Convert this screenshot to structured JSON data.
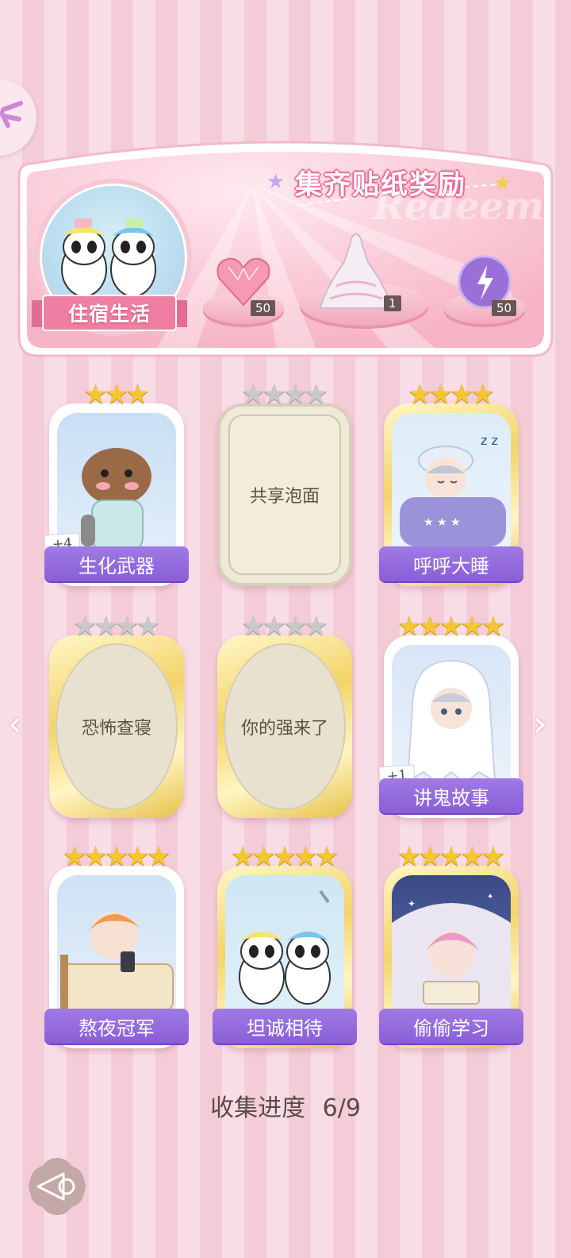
{
  "banner": {
    "title": "集齐贴纸奖励",
    "watermark": "Redeem",
    "theme_label": "住宿生活",
    "rewards": [
      {
        "icon": "heart-gem-icon",
        "qty": "50"
      },
      {
        "icon": "dress-icon",
        "qty": "1"
      },
      {
        "icon": "energy-orb-icon",
        "qty": "50"
      }
    ]
  },
  "cards": [
    {
      "title": "生化武器",
      "stars": 3,
      "stars_total": 3,
      "state": "unlocked",
      "plus": "+4",
      "art": "capybara-pajamas"
    },
    {
      "title": "共享泡面",
      "stars": 0,
      "stars_total": 4,
      "state": "locked",
      "art": "none"
    },
    {
      "title": "呼呼大睡",
      "stars": 4,
      "stars_total": 4,
      "state": "unlocked",
      "art": "boy-sleeping"
    },
    {
      "title": "恐怖查寝",
      "stars": 0,
      "stars_total": 4,
      "state": "locked",
      "art": "none"
    },
    {
      "title": "你的强来了",
      "stars": 0,
      "stars_total": 4,
      "state": "locked",
      "art": "none"
    },
    {
      "title": "讲鬼故事",
      "stars": 5,
      "stars_total": 5,
      "state": "unlocked",
      "plus": "+1",
      "art": "ghost-costume"
    },
    {
      "title": "熬夜冠军",
      "stars": 5,
      "stars_total": 5,
      "state": "unlocked",
      "art": "boy-phone-in-bed"
    },
    {
      "title": "坦诚相待",
      "stars": 5,
      "stars_total": 5,
      "state": "unlocked",
      "art": "pandas-shower"
    },
    {
      "title": "偷偷学习",
      "stars": 5,
      "stars_total": 5,
      "state": "unlocked",
      "art": "boy-reading-under-blanket"
    }
  ],
  "progress": {
    "label": "收集进度",
    "value": "6/9"
  },
  "colors": {
    "accent_purple": "#8a5ed7",
    "banner_pink": "#f7b8c8",
    "star_gold": "#f4c634"
  }
}
